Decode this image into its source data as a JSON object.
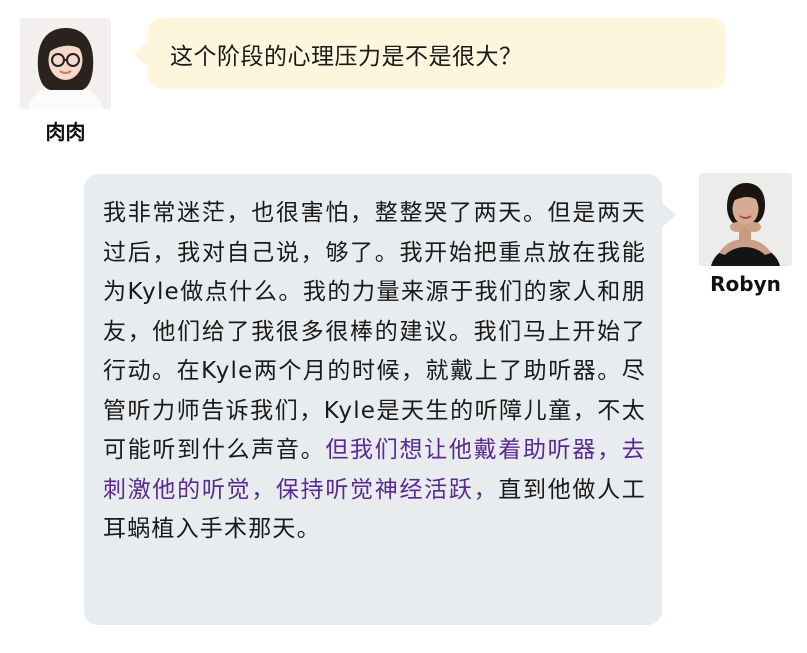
{
  "messages": [
    {
      "sender": "肉肉",
      "side": "left",
      "bubble_color": "#fdf6dd",
      "text": "这个阶段的心理压力是不是很大？"
    },
    {
      "sender": "Robyn",
      "side": "right",
      "bubble_color": "#e9ecee",
      "text": "我非常迷茫，也很害怕，整整哭了两天。但是两天过后，我对自己说，够了。我开始把重点放在我能为Kyle做点什么。我的力量来源于我们的家人和朋友，他们给了我很多很棒的建议。我们马上开始了行动。在Kyle两个月的时候，就戴上了助听器。尽管听力师告诉我们，Kyle是天生的听障儿童，不太可能听到什么声音。",
      "highlight_text": "但我们想让他戴着助听器，去刺激他的听觉，保持听觉神经活跃，",
      "highlight_color": "#5a2a90",
      "text_after": "直到他做人工耳蜗植入手术那天。"
    }
  ]
}
